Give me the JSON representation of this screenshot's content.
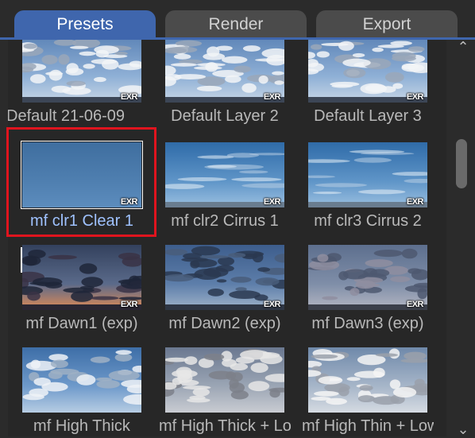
{
  "tabs": [
    {
      "label": "Presets",
      "active": true
    },
    {
      "label": "Render",
      "active": false
    },
    {
      "label": "Export",
      "active": false
    }
  ],
  "presets": [
    {
      "label": "Default 21-06-09",
      "badge": "EXR",
      "sky": "cumulus-sunny"
    },
    {
      "label": "Default Layer 2",
      "badge": "EXR",
      "sky": "cumulus-sunny"
    },
    {
      "label": "Default Layer 3",
      "badge": "EXR",
      "sky": "cumulus-sunny"
    },
    {
      "label": "mf clr1 Clear 1",
      "badge": "EXR",
      "sky": "clear",
      "selected": true
    },
    {
      "label": "mf clr2 Cirrus 1",
      "badge": "EXR",
      "sky": "cirrus"
    },
    {
      "label": "mf clr3 Cirrus 2",
      "badge": "EXR",
      "sky": "cirrus"
    },
    {
      "label": "mf Dawn1 (exp)",
      "badge": "EXR",
      "sky": "dawn-orange"
    },
    {
      "label": "mf Dawn2 (exp)",
      "badge": "EXR",
      "sky": "dawn-blue"
    },
    {
      "label": "mf Dawn3 (exp)",
      "badge": "EXR",
      "sky": "dawn-grey"
    },
    {
      "label": "mf High Thick",
      "badge": "",
      "sky": "high-thick"
    },
    {
      "label": "mf High Thick + Low",
      "badge": "",
      "sky": "high-thick-grey"
    },
    {
      "label": "mf High Thin + Low",
      "badge": "",
      "sky": "high-thin"
    }
  ],
  "colors": {
    "accent": "#3f66ad",
    "highlight": "#e0141e",
    "selected_label": "#9fc2ff"
  }
}
